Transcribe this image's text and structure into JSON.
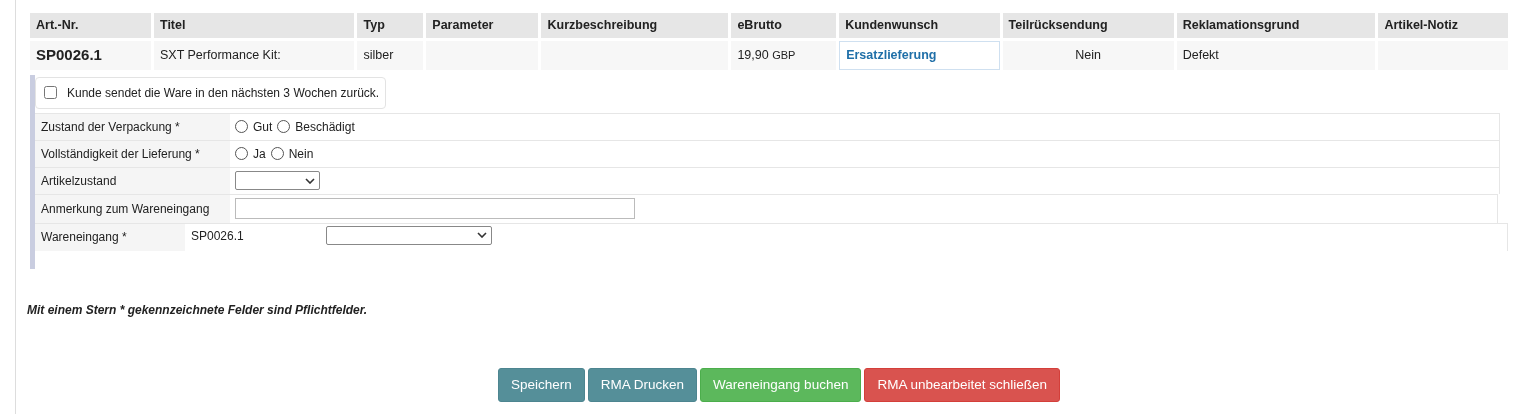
{
  "table": {
    "columns": [
      "Art.-Nr.",
      "Titel",
      "Typ",
      "Parameter",
      "Kurzbeschreibung",
      "eBrutto",
      "Kundenwunsch",
      "Teilrücksendung",
      "Reklamationsgrund",
      "Artikel-Notiz"
    ],
    "row": {
      "art_nr": "SP0026.1",
      "titel": "SXT Performance Kit:",
      "typ": "silber",
      "ebrutto": "19,90",
      "currency": "GBP",
      "kundenwunsch": "Ersatzlieferung",
      "teilruecksendung": "Nein",
      "reklamationsgrund": "Defekt"
    }
  },
  "return_checkbox": {
    "label": "Kunde sendet die Ware in den nächsten 3 Wochen zurück.",
    "checked": false
  },
  "fields": [
    {
      "kind": "radio",
      "label": "Zustand der Verpackung *",
      "options": [
        {
          "label": "Gut",
          "selected": false
        },
        {
          "label": "Beschädigt",
          "selected": false
        }
      ]
    },
    {
      "kind": "radio",
      "label": "Vollständigkeit der Lieferung *",
      "options": [
        {
          "label": "Ja",
          "selected": false
        },
        {
          "label": "Nein",
          "selected": false
        }
      ]
    },
    {
      "kind": "select",
      "label": "Artikelzustand"
    },
    {
      "kind": "text",
      "label": "Anmerkung zum Wareneingang"
    },
    {
      "kind": "article_select",
      "label": "Wareneingang *",
      "article": "SP0026.1"
    }
  ],
  "note": "Mit einem Stern * gekennzeichnete Felder sind Pflichtfelder.",
  "buttons": [
    {
      "label": "Speichern",
      "kind": "info"
    },
    {
      "label": "RMA Drucken",
      "kind": "info"
    },
    {
      "label": "Wareneingang buchen",
      "kind": "success"
    },
    {
      "label": "RMA unbearbeitet schließen",
      "kind": "danger"
    }
  ]
}
